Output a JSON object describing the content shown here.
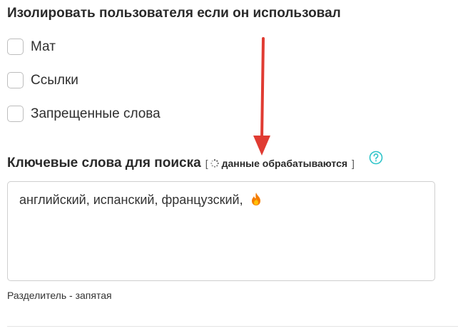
{
  "isolation": {
    "title": "Изолировать пользователя если он использовал",
    "options": [
      {
        "label": "Мат",
        "checked": false
      },
      {
        "label": "Ссылки",
        "checked": false
      },
      {
        "label": "Запрещенные слова",
        "checked": false
      }
    ]
  },
  "keywords": {
    "title": "Ключевые слова для поиска",
    "status_open": "[",
    "status_text": "данные обрабатываются",
    "status_close": "]",
    "value": "английский, испанский, французский,",
    "hint": "Разделитель - запятая"
  },
  "colors": {
    "help_icon": "#2ec4c9",
    "annotation_arrow": "#e03b32"
  }
}
